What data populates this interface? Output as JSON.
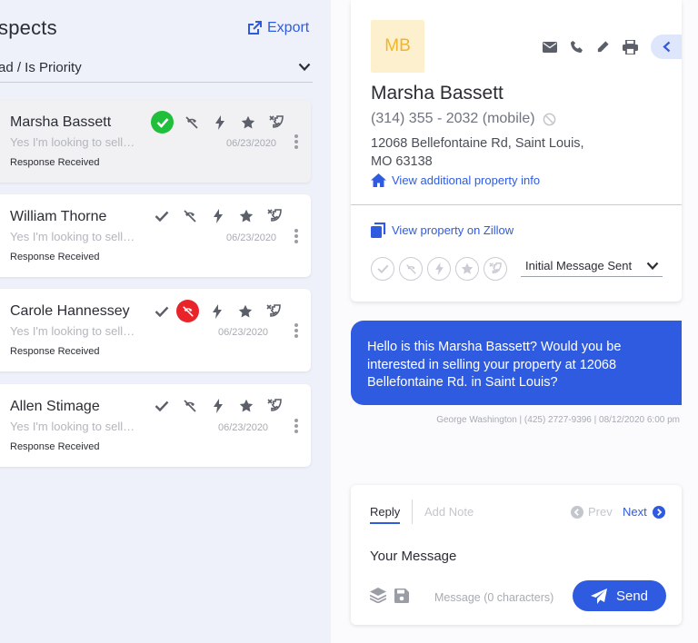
{
  "left": {
    "title": "spects",
    "export_label": "Export",
    "sort_label": "ad / Is Priority"
  },
  "prospects": [
    {
      "name": "Marsha Bassett",
      "snippet": "Yes I'm looking to sell…",
      "date": "06/23/2020",
      "status": "Response Received"
    },
    {
      "name": "William Thorne",
      "snippet": "Yes I'm looking to sell…",
      "date": "06/23/2020",
      "status": "Response Received"
    },
    {
      "name": "Carole Hannessey",
      "snippet": "Yes I'm looking to sell…",
      "date": "06/23/2020",
      "status": "Response Received"
    },
    {
      "name": "Allen Stimage",
      "snippet": "Yes I'm looking to sell…",
      "date": "06/23/2020",
      "status": "Response Received"
    }
  ],
  "profile": {
    "initials": "MB",
    "name": "Marsha Bassett",
    "phone": "(314) 355 - 2032 (mobile)",
    "address_line1": "12068 Bellefontaine Rd, Saint Louis,",
    "address_line2": "MO 63138",
    "property_info_link": "View additional property info",
    "zillow_link": "View property on Zillow",
    "stage": "Initial Message Sent"
  },
  "conversation": {
    "message": "Hello is this Marsha Bassett? Would you be interested in selling your property at 12068 Bellefontaine Rd. in Saint Louis?",
    "meta": "George Washington | (425) 2727-9396 | 08/12/2020 6:00 pm"
  },
  "composer": {
    "tab_reply": "Reply",
    "tab_note": "Add Note",
    "prev_label": "Prev",
    "next_label": "Next",
    "message_placeholder": "Your Message",
    "char_count": "Message (0 characters)",
    "send_label": "Send"
  },
  "colors": {
    "accent": "#2f5be0",
    "success": "#1fbf3b",
    "danger": "#e8232a",
    "avatar_bg": "#fdf0cf",
    "avatar_text": "#f1b528"
  },
  "icons": [
    "external-link-icon",
    "chevron-down-icon",
    "check-icon",
    "call-declined-icon",
    "bolt-icon",
    "star-icon",
    "missed-call-icon",
    "kebab-icon",
    "envelope-icon",
    "phone-icon",
    "pencil-icon",
    "printer-icon",
    "chevron-left-icon",
    "blocked-icon",
    "home-icon",
    "copy-icon",
    "paper-plane-icon",
    "layers-icon",
    "save-icon"
  ]
}
